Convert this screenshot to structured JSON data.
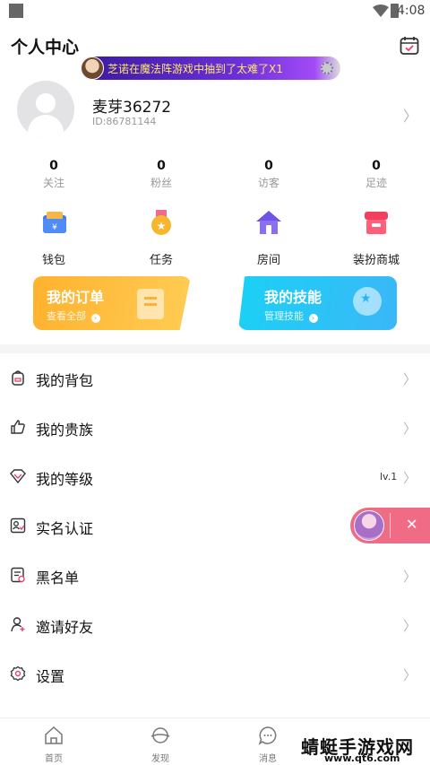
{
  "status_bar": {
    "time": "4:08"
  },
  "header": {
    "title": "个人中心",
    "icon": "calendar-icon"
  },
  "ticker": {
    "text": "芝诺在魔法阵游戏中抽到了太难了X1"
  },
  "profile": {
    "name": "麦芽36272",
    "id": "ID:86781144"
  },
  "stats": [
    {
      "value": "0",
      "label": "关注"
    },
    {
      "value": "0",
      "label": "粉丝"
    },
    {
      "value": "0",
      "label": "访客"
    },
    {
      "value": "0",
      "label": "足迹"
    }
  ],
  "quick_actions": [
    {
      "label": "钱包",
      "icon": "wallet-icon"
    },
    {
      "label": "任务",
      "icon": "task-medal-icon"
    },
    {
      "label": "房间",
      "icon": "house-icon"
    },
    {
      "label": "装扮商城",
      "icon": "shop-icon"
    }
  ],
  "cards": {
    "orders": {
      "title": "我的订单",
      "sub": "查看全部"
    },
    "skills": {
      "title": "我的技能",
      "sub": "管理技能"
    }
  },
  "menu": [
    {
      "label": "我的背包",
      "icon": "backpack-icon",
      "value": ""
    },
    {
      "label": "我的贵族",
      "icon": "thumbs-up-icon",
      "value": ""
    },
    {
      "label": "我的等级",
      "icon": "diamond-icon",
      "value": "lv.1"
    },
    {
      "label": "实名认证",
      "icon": "id-card-icon",
      "value": ""
    },
    {
      "label": "黑名单",
      "icon": "blacklist-icon",
      "value": ""
    },
    {
      "label": "邀请好友",
      "icon": "invite-user-icon",
      "value": ""
    },
    {
      "label": "设置",
      "icon": "settings-icon",
      "value": ""
    }
  ],
  "tabs": [
    {
      "label": "首页",
      "icon": "home-icon"
    },
    {
      "label": "发现",
      "icon": "discover-icon"
    },
    {
      "label": "消息",
      "icon": "message-icon"
    }
  ],
  "watermark": {
    "main": "蜻蜓手游戏网",
    "sub": "www.qt6.com"
  },
  "colors": {
    "orders_card": "#ffb22e",
    "skills_card": "#1ad1f5",
    "float_widget": "#f06c86",
    "ticker": "#6a2fd8"
  }
}
